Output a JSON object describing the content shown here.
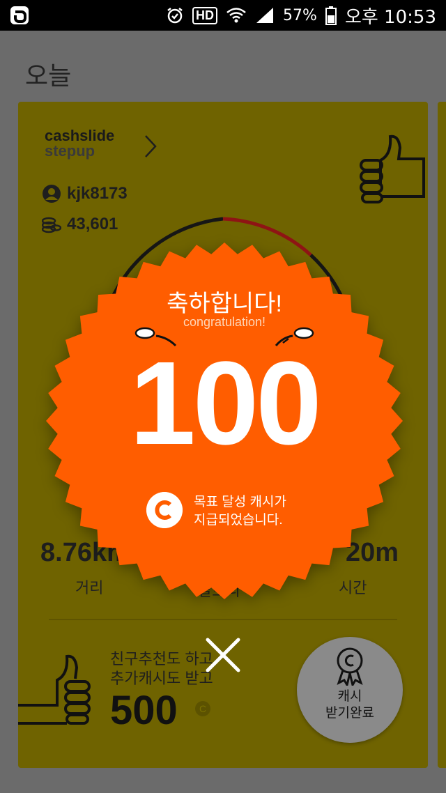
{
  "status": {
    "battery": "57%",
    "time": "오후 10:53",
    "hd": "HD"
  },
  "page": {
    "title": "오늘"
  },
  "card": {
    "brand_line1": "cashslide",
    "brand_line2": "stepup",
    "username": "kjk8173",
    "coins": "43,601",
    "distance": "8.76km",
    "distance_label": "거리",
    "calorie_label": "칼로리",
    "time": "20m",
    "time_label": "시간"
  },
  "promo": {
    "line1": "친구추천도 하고",
    "line2": "추가캐시도 받고",
    "amount": "500"
  },
  "cash_button": {
    "line1": "캐시",
    "line2": "받기완료"
  },
  "dialog": {
    "title": "축하합니다!",
    "subtitle": "congratulation!",
    "value": "100",
    "msg_line1": "목표 달성 캐시가",
    "msg_line2": "지급되었습니다."
  },
  "colors": {
    "burst": "#ff5d00",
    "card": "#6f6300",
    "overlay": "#6b6b6b"
  }
}
